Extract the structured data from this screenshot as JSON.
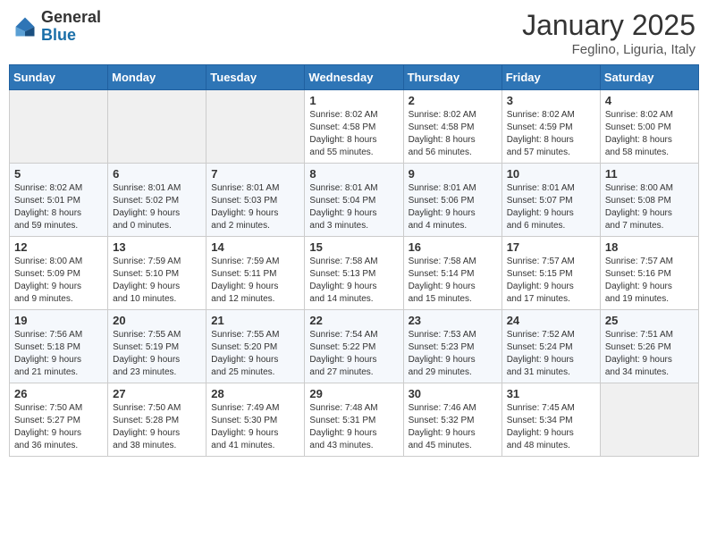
{
  "header": {
    "logo_general": "General",
    "logo_blue": "Blue",
    "month": "January 2025",
    "location": "Feglino, Liguria, Italy"
  },
  "days_of_week": [
    "Sunday",
    "Monday",
    "Tuesday",
    "Wednesday",
    "Thursday",
    "Friday",
    "Saturday"
  ],
  "weeks": [
    [
      {
        "day": "",
        "info": ""
      },
      {
        "day": "",
        "info": ""
      },
      {
        "day": "",
        "info": ""
      },
      {
        "day": "1",
        "info": "Sunrise: 8:02 AM\nSunset: 4:58 PM\nDaylight: 8 hours\nand 55 minutes."
      },
      {
        "day": "2",
        "info": "Sunrise: 8:02 AM\nSunset: 4:58 PM\nDaylight: 8 hours\nand 56 minutes."
      },
      {
        "day": "3",
        "info": "Sunrise: 8:02 AM\nSunset: 4:59 PM\nDaylight: 8 hours\nand 57 minutes."
      },
      {
        "day": "4",
        "info": "Sunrise: 8:02 AM\nSunset: 5:00 PM\nDaylight: 8 hours\nand 58 minutes."
      }
    ],
    [
      {
        "day": "5",
        "info": "Sunrise: 8:02 AM\nSunset: 5:01 PM\nDaylight: 8 hours\nand 59 minutes."
      },
      {
        "day": "6",
        "info": "Sunrise: 8:01 AM\nSunset: 5:02 PM\nDaylight: 9 hours\nand 0 minutes."
      },
      {
        "day": "7",
        "info": "Sunrise: 8:01 AM\nSunset: 5:03 PM\nDaylight: 9 hours\nand 2 minutes."
      },
      {
        "day": "8",
        "info": "Sunrise: 8:01 AM\nSunset: 5:04 PM\nDaylight: 9 hours\nand 3 minutes."
      },
      {
        "day": "9",
        "info": "Sunrise: 8:01 AM\nSunset: 5:06 PM\nDaylight: 9 hours\nand 4 minutes."
      },
      {
        "day": "10",
        "info": "Sunrise: 8:01 AM\nSunset: 5:07 PM\nDaylight: 9 hours\nand 6 minutes."
      },
      {
        "day": "11",
        "info": "Sunrise: 8:00 AM\nSunset: 5:08 PM\nDaylight: 9 hours\nand 7 minutes."
      }
    ],
    [
      {
        "day": "12",
        "info": "Sunrise: 8:00 AM\nSunset: 5:09 PM\nDaylight: 9 hours\nand 9 minutes."
      },
      {
        "day": "13",
        "info": "Sunrise: 7:59 AM\nSunset: 5:10 PM\nDaylight: 9 hours\nand 10 minutes."
      },
      {
        "day": "14",
        "info": "Sunrise: 7:59 AM\nSunset: 5:11 PM\nDaylight: 9 hours\nand 12 minutes."
      },
      {
        "day": "15",
        "info": "Sunrise: 7:58 AM\nSunset: 5:13 PM\nDaylight: 9 hours\nand 14 minutes."
      },
      {
        "day": "16",
        "info": "Sunrise: 7:58 AM\nSunset: 5:14 PM\nDaylight: 9 hours\nand 15 minutes."
      },
      {
        "day": "17",
        "info": "Sunrise: 7:57 AM\nSunset: 5:15 PM\nDaylight: 9 hours\nand 17 minutes."
      },
      {
        "day": "18",
        "info": "Sunrise: 7:57 AM\nSunset: 5:16 PM\nDaylight: 9 hours\nand 19 minutes."
      }
    ],
    [
      {
        "day": "19",
        "info": "Sunrise: 7:56 AM\nSunset: 5:18 PM\nDaylight: 9 hours\nand 21 minutes."
      },
      {
        "day": "20",
        "info": "Sunrise: 7:55 AM\nSunset: 5:19 PM\nDaylight: 9 hours\nand 23 minutes."
      },
      {
        "day": "21",
        "info": "Sunrise: 7:55 AM\nSunset: 5:20 PM\nDaylight: 9 hours\nand 25 minutes."
      },
      {
        "day": "22",
        "info": "Sunrise: 7:54 AM\nSunset: 5:22 PM\nDaylight: 9 hours\nand 27 minutes."
      },
      {
        "day": "23",
        "info": "Sunrise: 7:53 AM\nSunset: 5:23 PM\nDaylight: 9 hours\nand 29 minutes."
      },
      {
        "day": "24",
        "info": "Sunrise: 7:52 AM\nSunset: 5:24 PM\nDaylight: 9 hours\nand 31 minutes."
      },
      {
        "day": "25",
        "info": "Sunrise: 7:51 AM\nSunset: 5:26 PM\nDaylight: 9 hours\nand 34 minutes."
      }
    ],
    [
      {
        "day": "26",
        "info": "Sunrise: 7:50 AM\nSunset: 5:27 PM\nDaylight: 9 hours\nand 36 minutes."
      },
      {
        "day": "27",
        "info": "Sunrise: 7:50 AM\nSunset: 5:28 PM\nDaylight: 9 hours\nand 38 minutes."
      },
      {
        "day": "28",
        "info": "Sunrise: 7:49 AM\nSunset: 5:30 PM\nDaylight: 9 hours\nand 41 minutes."
      },
      {
        "day": "29",
        "info": "Sunrise: 7:48 AM\nSunset: 5:31 PM\nDaylight: 9 hours\nand 43 minutes."
      },
      {
        "day": "30",
        "info": "Sunrise: 7:46 AM\nSunset: 5:32 PM\nDaylight: 9 hours\nand 45 minutes."
      },
      {
        "day": "31",
        "info": "Sunrise: 7:45 AM\nSunset: 5:34 PM\nDaylight: 9 hours\nand 48 minutes."
      },
      {
        "day": "",
        "info": ""
      }
    ]
  ]
}
